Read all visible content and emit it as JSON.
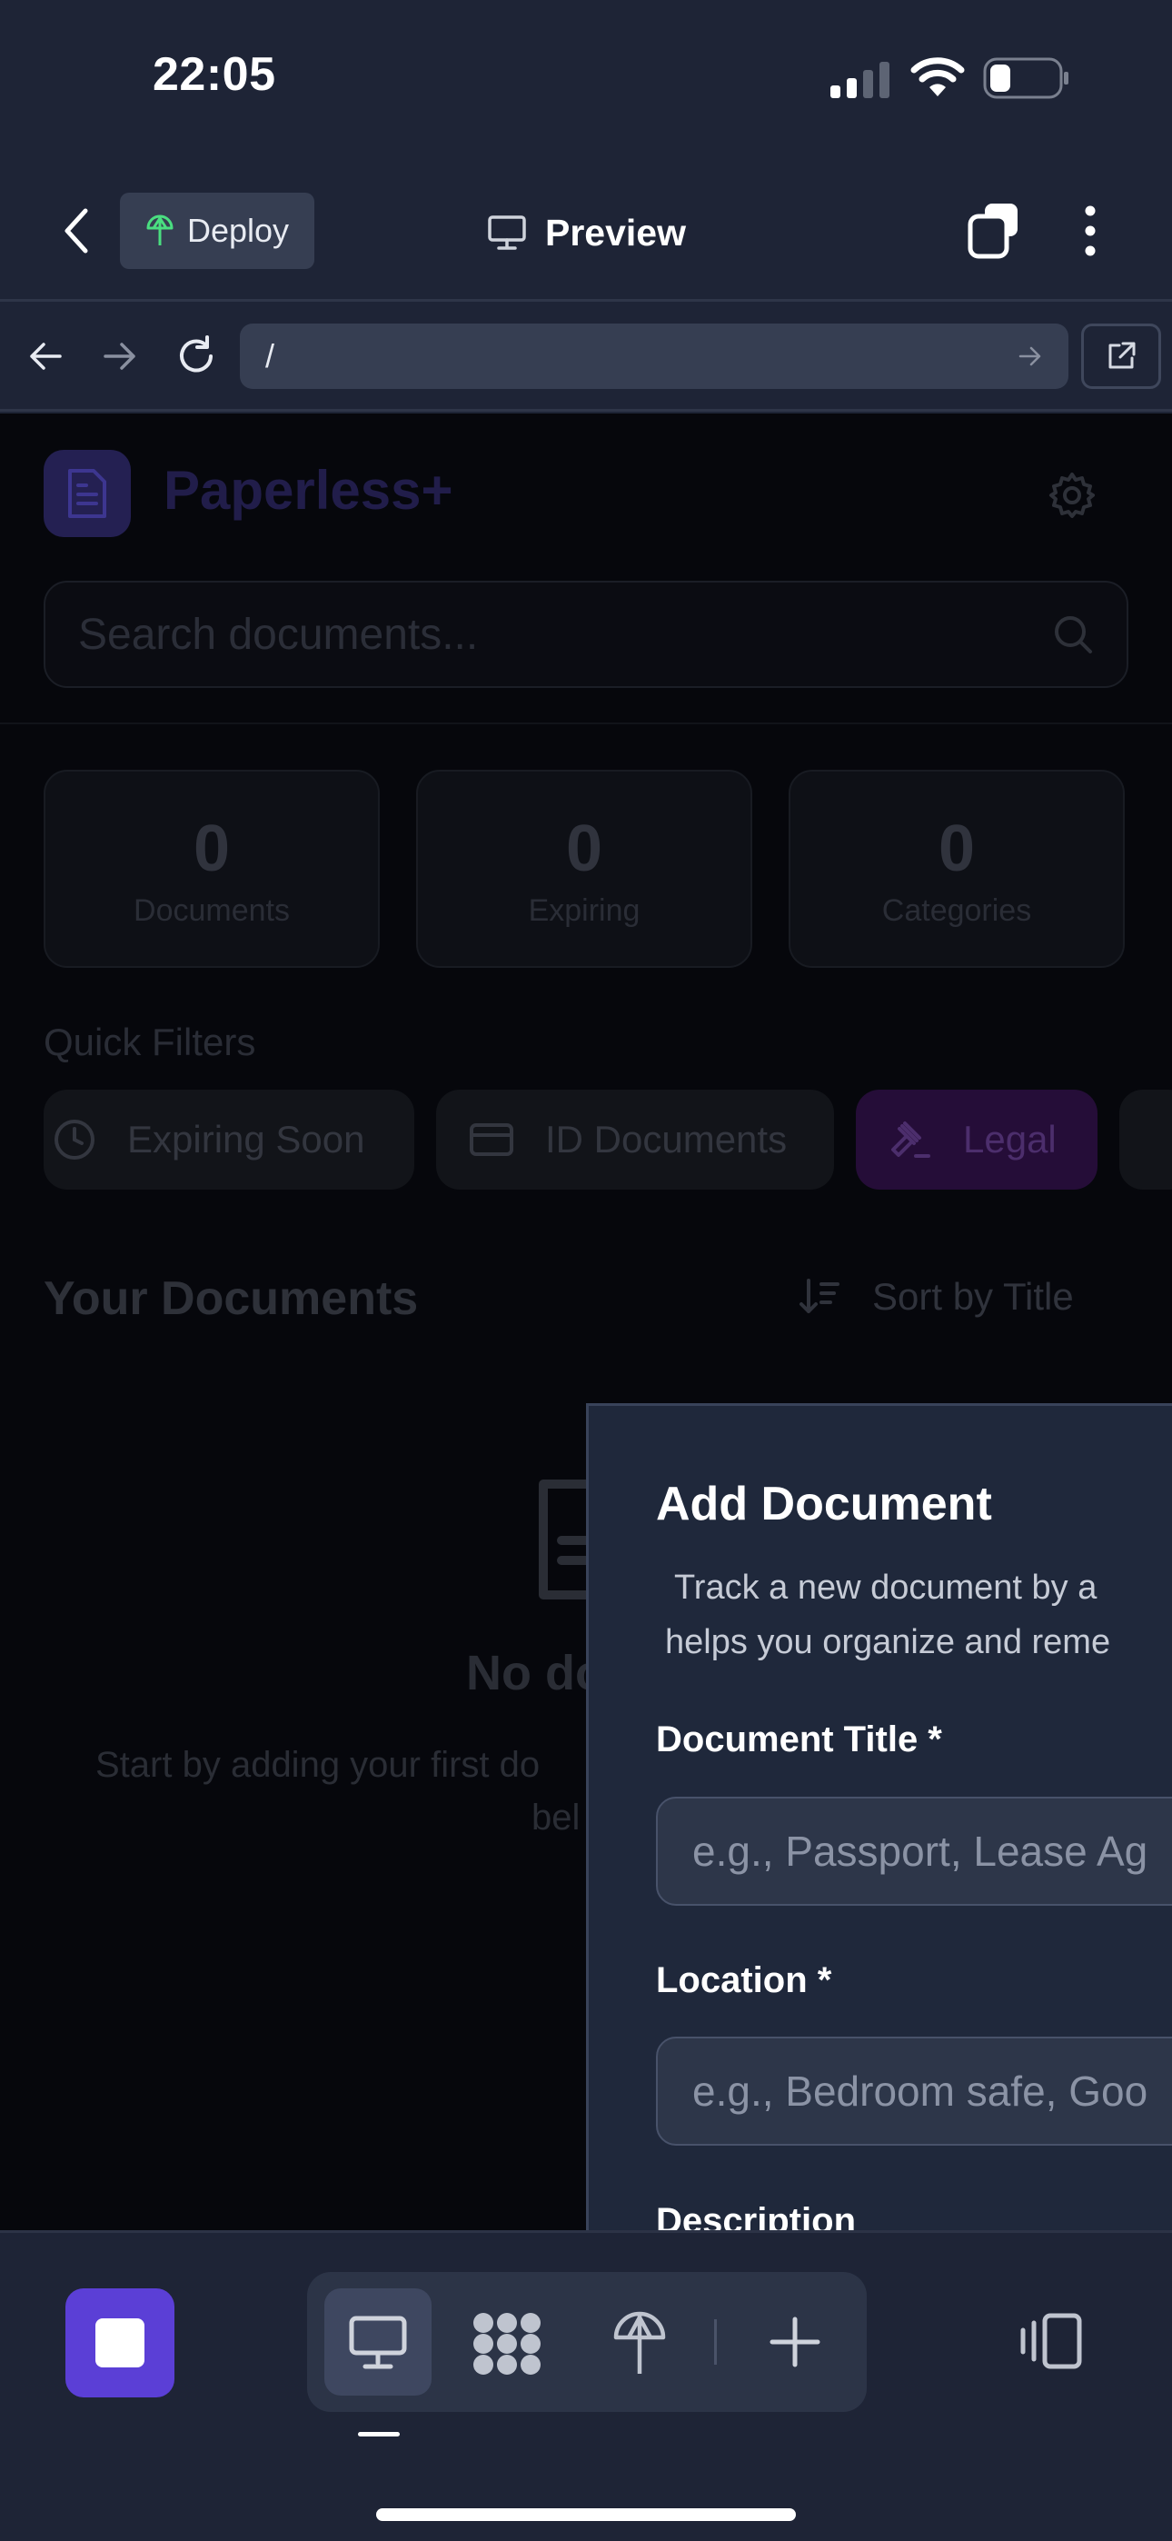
{
  "status_bar": {
    "time": "22:05"
  },
  "header": {
    "deploy_label": "Deploy",
    "title": "Preview",
    "icons": [
      "back-chevron-icon",
      "deploy-icon",
      "monitor-icon",
      "tabs-icon",
      "more-vertical-icon"
    ]
  },
  "browser": {
    "url": "/",
    "icons": [
      "back-arrow-icon",
      "forward-arrow-icon",
      "reload-icon",
      "go-arrow-icon",
      "external-link-icon"
    ]
  },
  "app": {
    "brand": "Paperless+",
    "search_placeholder": "Search documents...",
    "stats": [
      {
        "value": "0",
        "label": "Documents"
      },
      {
        "value": "0",
        "label": "Expiring"
      },
      {
        "value": "0",
        "label": "Categories"
      }
    ],
    "quick_filters_title": "Quick Filters",
    "quick_filters": [
      {
        "label": "Expiring Soon",
        "icon": "clock-icon"
      },
      {
        "label": "ID Documents",
        "icon": "card-icon"
      },
      {
        "label": "Legal",
        "icon": "gavel-icon"
      }
    ],
    "documents_title": "Your Documents",
    "sort_label": "Sort by Title",
    "empty_title_visible": "No docum",
    "empty_text_line1": "Start by adding your first do",
    "empty_text_line2": "bel"
  },
  "sheet": {
    "title": "Add Document",
    "description_line1": "Track a new document by a",
    "description_line2": "helps you organize and reme",
    "fields": [
      {
        "label": "Document Title *",
        "placeholder": "e.g., Passport, Lease Ag"
      },
      {
        "label": "Location *",
        "placeholder": "e.g., Bedroom safe, Goo"
      }
    ],
    "next_label_partial": "Description"
  },
  "toolbar": {
    "tools": [
      "monitor-icon",
      "grid-blob-icon",
      "deploy-icon",
      "plus-icon"
    ],
    "active_tool": "monitor-icon"
  },
  "colors": {
    "background": "#1e2436",
    "accent": "#5b3fd6",
    "sheet": "#1f283b",
    "overlay": "#06070c"
  }
}
